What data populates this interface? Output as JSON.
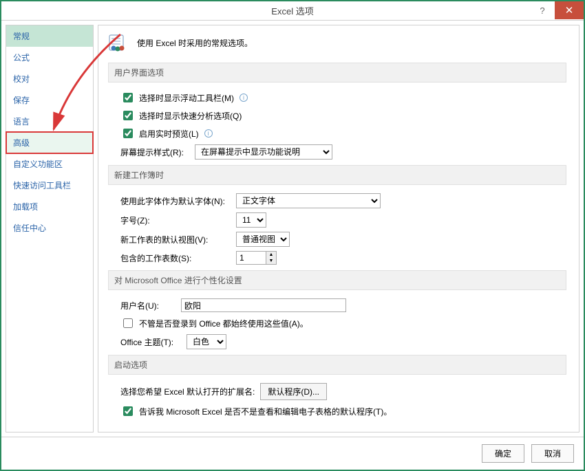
{
  "window": {
    "title": "Excel 选项",
    "help": "?",
    "close": "✕"
  },
  "sidebar": {
    "items": [
      {
        "label": "常规",
        "active": true
      },
      {
        "label": "公式"
      },
      {
        "label": "校对"
      },
      {
        "label": "保存"
      },
      {
        "label": "语言"
      },
      {
        "label": "高级",
        "highlighted": true
      },
      {
        "label": "自定义功能区"
      },
      {
        "label": "快速访问工具栏"
      },
      {
        "label": "加载项"
      },
      {
        "label": "信任中心"
      }
    ]
  },
  "content": {
    "intro": "使用 Excel 时采用的常规选项。",
    "sections": {
      "ui": {
        "header": "用户界面选项",
        "opt_minitoolbar": "选择时显示浮动工具栏(M)",
        "opt_quickanalysis": "选择时显示快速分析选项(Q)",
        "opt_livepreview": "启用实时预览(L)",
        "screentip_label": "屏幕提示样式(R):",
        "screentip_value": "在屏幕提示中显示功能说明"
      },
      "newwb": {
        "header": "新建工作簿时",
        "font_label": "使用此字体作为默认字体(N):",
        "font_value": "正文字体",
        "size_label": "字号(Z):",
        "size_value": "11",
        "view_label": "新工作表的默认视图(V):",
        "view_value": "普通视图",
        "sheets_label": "包含的工作表数(S):",
        "sheets_value": "1"
      },
      "personalize": {
        "header": "对 Microsoft Office 进行个性化设置",
        "username_label": "用户名(U):",
        "username_value": "欧阳",
        "always_use": "不管是否登录到 Office 都始终使用这些值(A)。",
        "theme_label": "Office 主题(T):",
        "theme_value": "白色"
      },
      "startup": {
        "header": "启动选项",
        "ext_label": "选择您希望 Excel 默认打开的扩展名:",
        "ext_btn": "默认程序(D)...",
        "tellme": "告诉我 Microsoft Excel 是否不是查看和编辑电子表格的默认程序(T)。"
      }
    }
  },
  "footer": {
    "ok": "确定",
    "cancel": "取消"
  }
}
